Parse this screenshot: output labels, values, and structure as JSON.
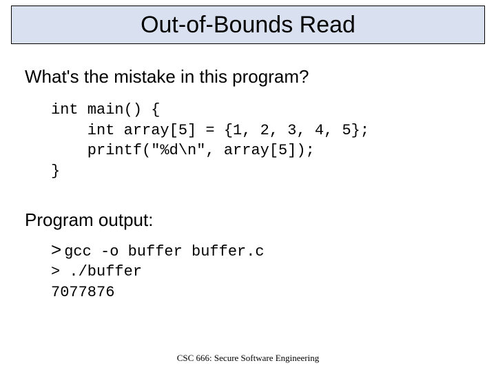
{
  "title": "Out-of-Bounds Read",
  "question": "What's the mistake in this program?",
  "code": "int main() {\n    int array[5] = {1, 2, 3, 4, 5};\n    printf(\"%d\\n\", array[5]);\n}",
  "output_label": "Program output:",
  "output": {
    "compile_prompt": ">",
    "compile_cmd": "gcc -o buffer buffer.c",
    "run_prompt": ">",
    "run_cmd": "./buffer",
    "result": "7077876"
  },
  "footer": "CSC 666: Secure Software Engineering"
}
